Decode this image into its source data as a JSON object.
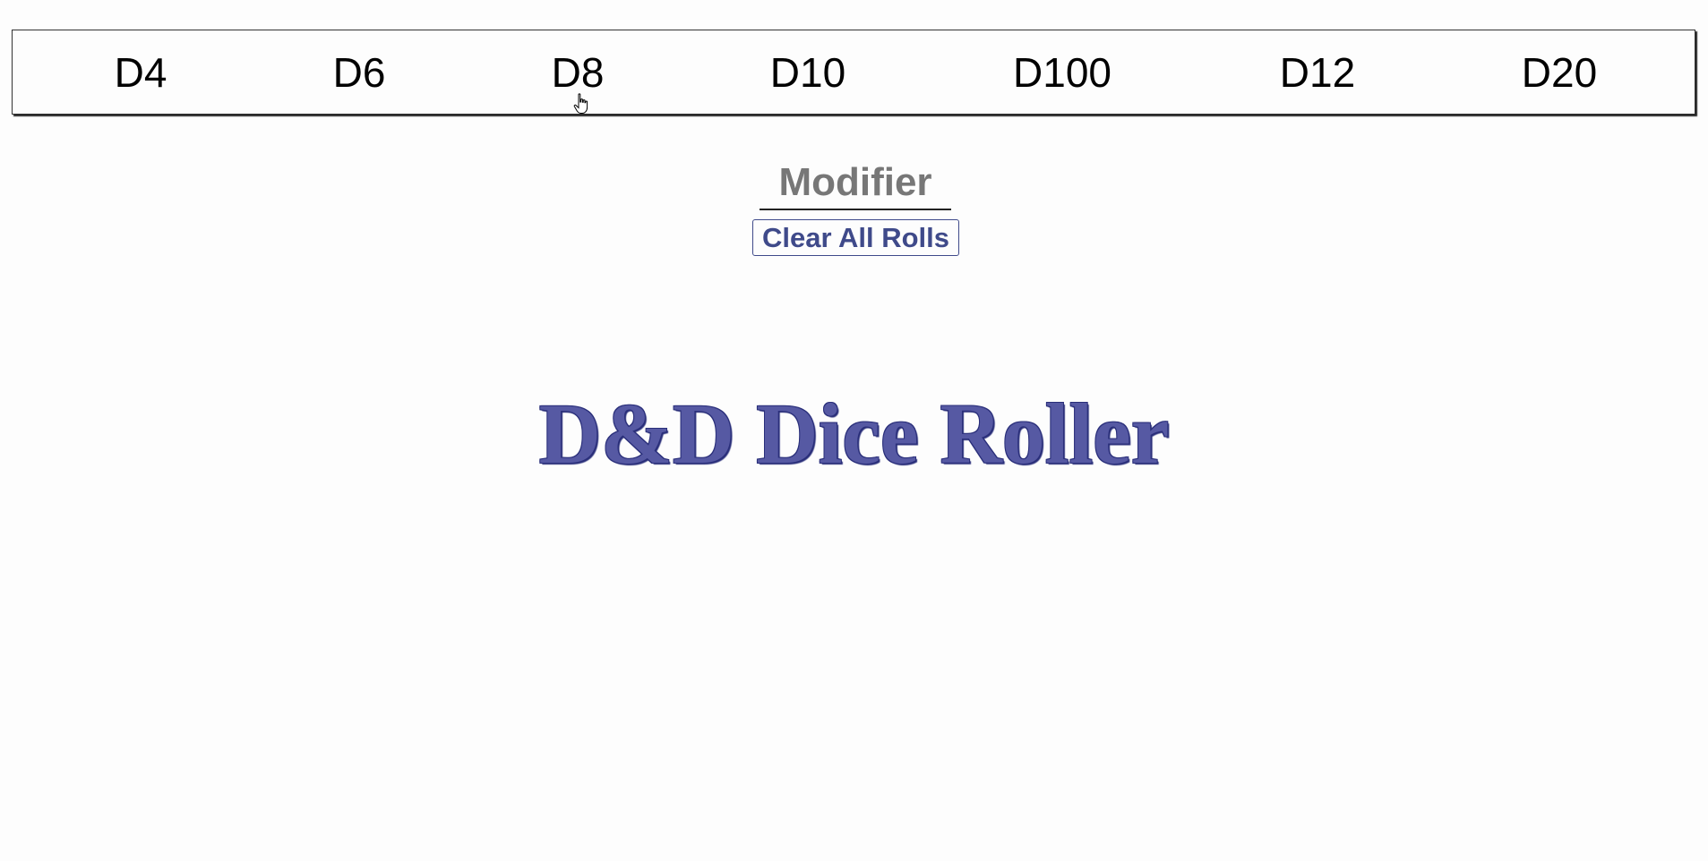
{
  "dice_bar": {
    "buttons": [
      {
        "label": "D4"
      },
      {
        "label": "D6"
      },
      {
        "label": "D8"
      },
      {
        "label": "D10"
      },
      {
        "label": "D100"
      },
      {
        "label": "D12"
      },
      {
        "label": "D20"
      }
    ]
  },
  "modifier": {
    "placeholder": "Modifier",
    "value": ""
  },
  "clear_button": {
    "label": "Clear All Rolls"
  },
  "title": {
    "text": "D&D Dice Roller"
  },
  "colors": {
    "accent": "#3f4a8a",
    "title": "#5659a3",
    "modifier_text": "#777777",
    "background": "#fdfdfd"
  },
  "icons": {
    "cursor": "hand-pointer-icon"
  }
}
